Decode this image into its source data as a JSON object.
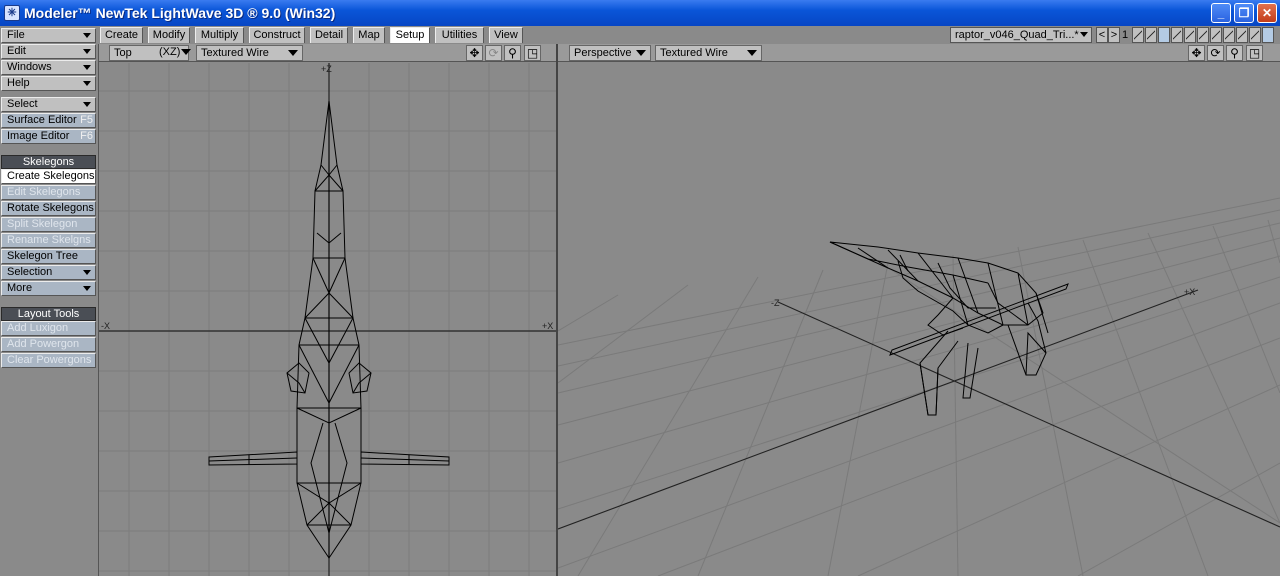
{
  "window": {
    "title": "Modeler™ NewTek LightWave 3D ® 9.0 (Win32)",
    "minimize": "_",
    "restore": "❐",
    "close": "✕"
  },
  "left_panel": {
    "menus": [
      {
        "label": "File"
      },
      {
        "label": "Edit"
      },
      {
        "label": "Windows"
      },
      {
        "label": "Help"
      }
    ],
    "select_label": "Select",
    "surface_editor": {
      "label": "Surface Editor",
      "key": "F5"
    },
    "image_editor": {
      "label": "Image Editor",
      "key": "F6"
    },
    "skelegons_header": "Skelegons",
    "skelegon_tools": [
      {
        "label": "Create Skelegons",
        "state": "active"
      },
      {
        "label": "Edit Skelegons",
        "state": "disabled"
      },
      {
        "label": "Rotate Skelegons",
        "state": "normal"
      },
      {
        "label": "Split Skelegon",
        "state": "disabled"
      },
      {
        "label": "Rename Skelgns",
        "state": "disabled"
      },
      {
        "label": "Skelegon Tree",
        "state": "normal"
      }
    ],
    "selection_label": "Selection",
    "more_label": "More",
    "layout_tools_header": "Layout Tools",
    "layout_tools": [
      {
        "label": "Add Luxigon"
      },
      {
        "label": "Add Powergon"
      },
      {
        "label": "Clear Powergons"
      }
    ]
  },
  "tabs": [
    "Create",
    "Modify",
    "Multiply",
    "Construct",
    "Detail",
    "Map",
    "Setup",
    "Utilities",
    "View"
  ],
  "active_tab": "Setup",
  "object_selector": "raptor_v046_Quad_Tri...*",
  "layer_prev": "<",
  "layer_next": ">",
  "layer_number": "1",
  "viewport_left": {
    "view": "Top",
    "axes": "(XZ)",
    "render_mode": "Textured Wire",
    "axis_labels": {
      "top": "+Z",
      "left": "-X",
      "right": "+X"
    }
  },
  "viewport_right": {
    "view": "Perspective",
    "render_mode": "Textured Wire",
    "axis_labels": {
      "z": "-Z",
      "x": "+X"
    }
  },
  "icons": {
    "move": "move-icon",
    "rotate": "rotate-icon",
    "zoom": "zoom-icon",
    "maximize": "maximize-icon"
  }
}
